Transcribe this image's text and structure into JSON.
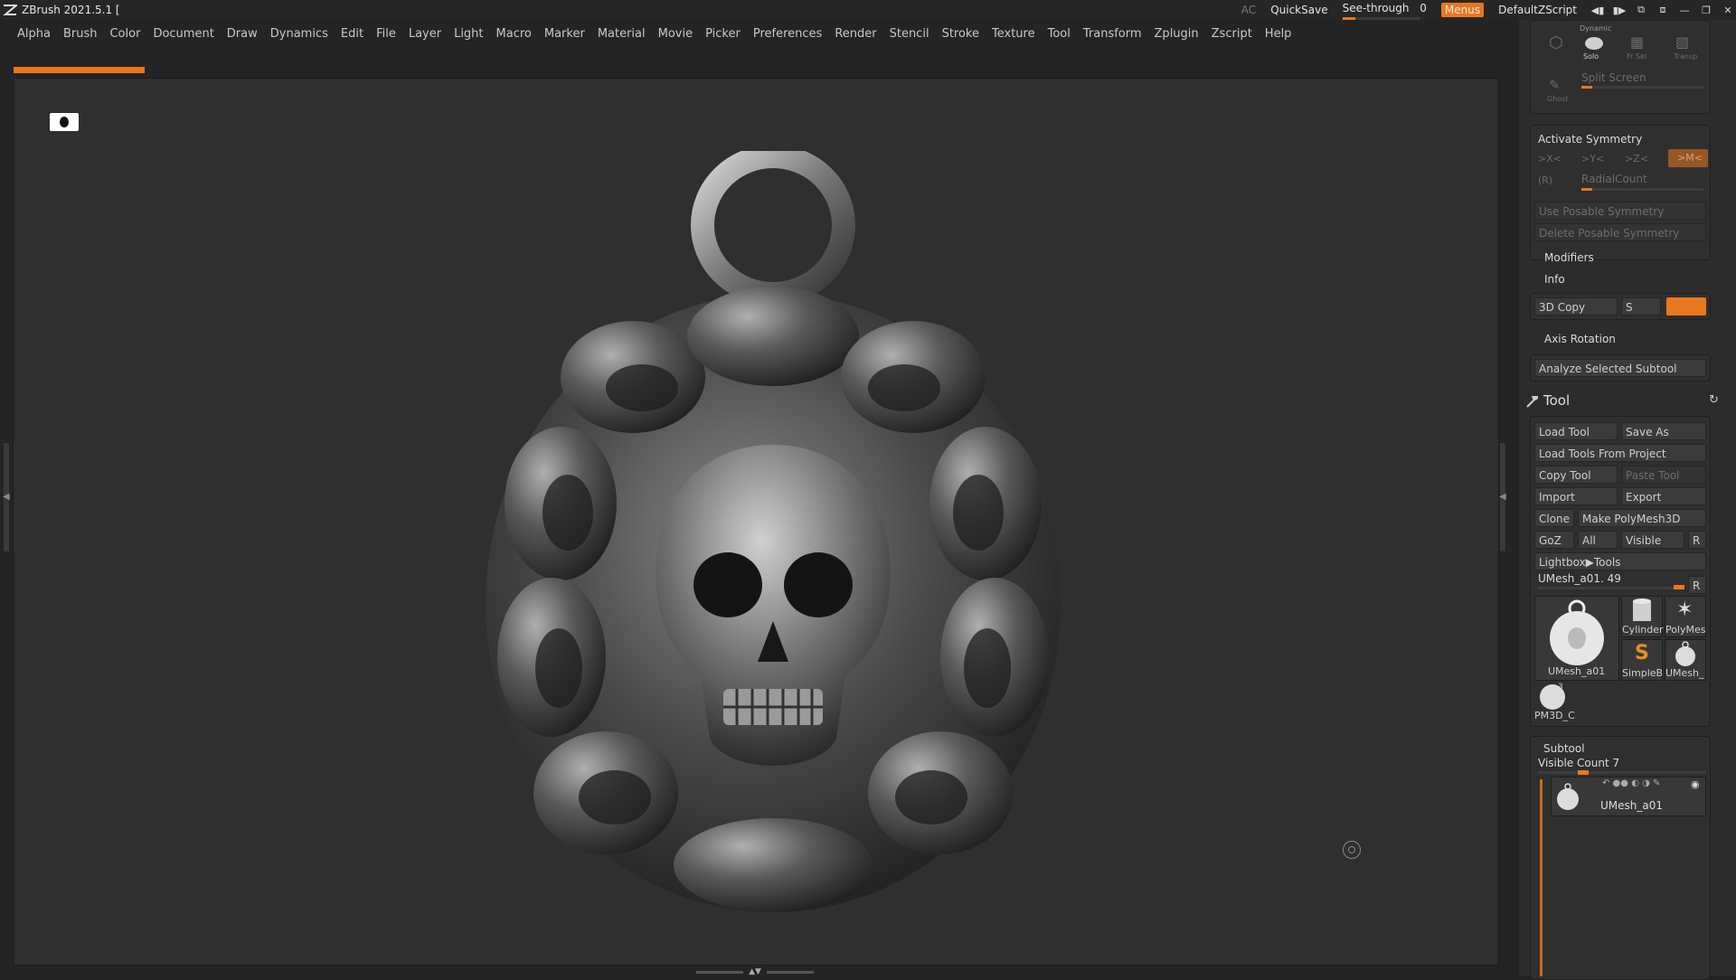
{
  "titlebar": {
    "app_title": "ZBrush 2021.5.1 [",
    "ac_label": "AC",
    "quicksave_label": "QuickSave",
    "seethrough_label": "See-through",
    "seethrough_value": "0",
    "menus_label": "Menus",
    "zscript_label": "DefaultZScript"
  },
  "menubar": {
    "items": [
      "Alpha",
      "Brush",
      "Color",
      "Document",
      "Draw",
      "Dynamics",
      "Edit",
      "File",
      "Layer",
      "Light",
      "Macro",
      "Marker",
      "Material",
      "Movie",
      "Picker",
      "Preferences",
      "Render",
      "Stencil",
      "Stroke",
      "Texture",
      "Tool",
      "Transform",
      "Zplugin",
      "Zscript",
      "Help"
    ]
  },
  "tray": {
    "top_group": {
      "dynamic_label": "Dynamic",
      "solo_label": "Solo",
      "frsel_label": "Fr Sel",
      "transp_label": "Transp",
      "ghost_label": "Ghost",
      "split_screen_label": "Split Screen"
    },
    "symmetry": {
      "activate_label": "Activate Symmetry",
      "x_label": ">X<",
      "y_label": ">Y<",
      "z_label": ">Z<",
      "m_label": ">M<",
      "r_label": "(R)",
      "radial_label": "RadialCount",
      "use_posable_label": "Use Posable Symmetry",
      "delete_posable_label": "Delete Posable Symmetry"
    },
    "modifiers_label": "Modifiers",
    "info_label": "Info",
    "copy3d_label": "3D Copy",
    "s_label": "S",
    "axis_rotation_label": "Axis Rotation",
    "analyze_label": "Analyze Selected Subtool",
    "tool": {
      "title": "Tool",
      "load_tool": "Load Tool",
      "save_as": "Save As",
      "load_from_project": "Load Tools From Project",
      "copy_tool": "Copy Tool",
      "paste_tool": "Paste Tool",
      "import": "Import",
      "export": "Export",
      "clone": "Clone",
      "make_polymesh": "Make PolyMesh3D",
      "goz": "GoZ",
      "all": "All",
      "visible": "Visible",
      "r": "R",
      "lightbox_tools": "Lightbox▶Tools",
      "current_tool": "UMesh_a01. 49",
      "thumbs": [
        "UMesh_a01",
        "Cylinder",
        "PolyMes",
        "SimpleB",
        "UMesh_",
        "PM3D_C"
      ],
      "thumb_badge": "3"
    },
    "subtool": {
      "title": "Subtool",
      "visible_count": "Visible Count 7",
      "item_name": "UMesh_a01"
    }
  },
  "colors": {
    "accent": "#e8781e",
    "background": "#242424",
    "viewport": "#2f2f2f",
    "panel": "#2f2f2f"
  }
}
